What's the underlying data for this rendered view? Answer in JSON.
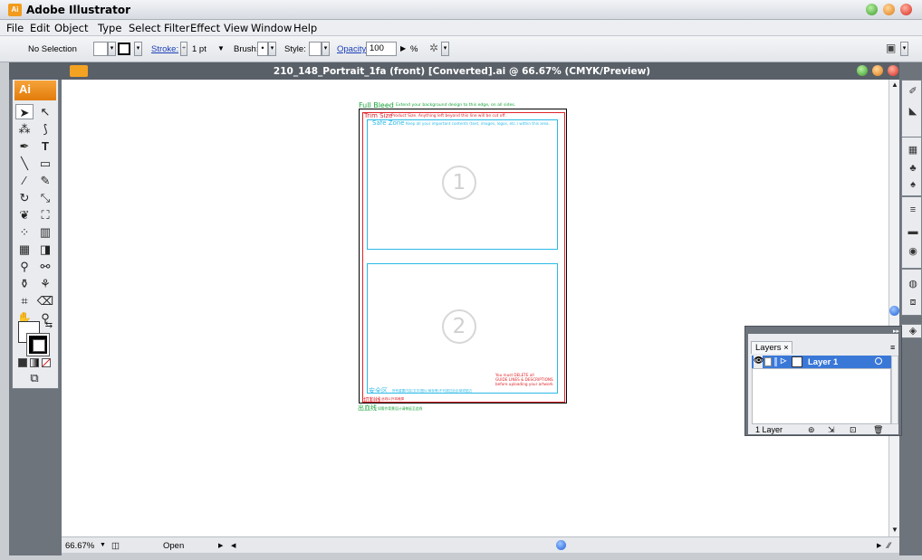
{
  "app": {
    "title": "Adobe Illustrator",
    "logo_text": "Ai"
  },
  "menu": [
    "File",
    "Edit",
    "Object",
    "Type",
    "Select",
    "Filter",
    "Effect",
    "View",
    "Window",
    "Help"
  ],
  "control_bar": {
    "selection": "No Selection",
    "stroke_label": "Stroke:",
    "stroke_value": "1 pt",
    "brush_label": "Brush:",
    "brush_value": "•",
    "style_label": "Style:",
    "opacity_label": "Opacity:",
    "opacity_value": "100",
    "opacity_unit": "%"
  },
  "document": {
    "title": "210_148_Portrait_1fa (front) [Converted].ai @ 66.67% (CMYK/Preview)",
    "zoom": "66.67%",
    "status": "Open"
  },
  "artboard": {
    "full_bleed_label": "Full Bleed",
    "full_bleed_note": "Extend your background design to this edge, on all sides.",
    "trim_label": "Trim Size",
    "trim_note": "Product Size. Anything left beyond this line will be cut off.",
    "safe_label": "Safe Zone",
    "safe_note": "Keep all your important contents (text, images, logos, etc.) within this area.",
    "panel_1": "1",
    "panel_2": "2",
    "delete_note_1": "You must DELETE all",
    "delete_note_2": "GUIDE LINES & DESCRIPTIONS",
    "delete_note_3": "before uploading your artwork",
    "cn_safe_label": "安全区",
    "cn_safe_note": "所有重要内容(文字/图片/商标等)不可超过此区域或贴边",
    "cn_trim_label": "切割线",
    "cn_trim_note": "此线以外将裁掉",
    "cn_bleed_label": "出血线",
    "cn_bleed_note": "如需作背景设计请伸延至此线"
  },
  "layers_panel": {
    "tab": "Layers",
    "close": "×",
    "layer_name": "Layer 1",
    "count": "1 Layer"
  },
  "colors": {
    "bleed": "#1aa33b",
    "trim": "#e0242b",
    "safe": "#2bb9e8",
    "accent": "#f29b1d",
    "selection": "#3a78d8"
  }
}
